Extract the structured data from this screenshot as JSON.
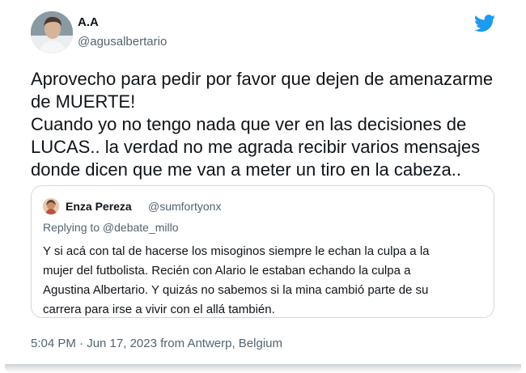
{
  "tweet": {
    "author": {
      "display_name": "A.A",
      "handle": "@agusalbertario",
      "avatar_icon": "profile-photo"
    },
    "brand_icon": "twitter-bird-icon",
    "brand_color": "#1d9bf0",
    "text_lines": [
      "Aprovecho para pedir por favor que dejen de amenazarme",
      "de MUERTE!",
      "Cuando yo no tengo nada que ver en las decisiones de",
      "LUCAS.. la verdad no me agrada recibir varios mensajes",
      "donde dicen que me van a meter un tiro en la cabeza.."
    ],
    "quoted": {
      "display_name": "Enza Pereza",
      "handle": "@sumfortyonx",
      "replying_to": "Replying to @debate_millo",
      "text_lines": [
        "Y si acá con tal de hacerse los misoginos siempre le echan la culpa a la",
        "mujer del futbolista. Recién con Alario le estaban echando la culpa a",
        "Agustina Albertario. Y quizás no sabemos si la mina cambió parte de su",
        "carrera para irse a vivir con el allá también."
      ]
    },
    "timestamp": "5:04 PM · Jun 17, 2023 from Antwerp, Belgium"
  }
}
